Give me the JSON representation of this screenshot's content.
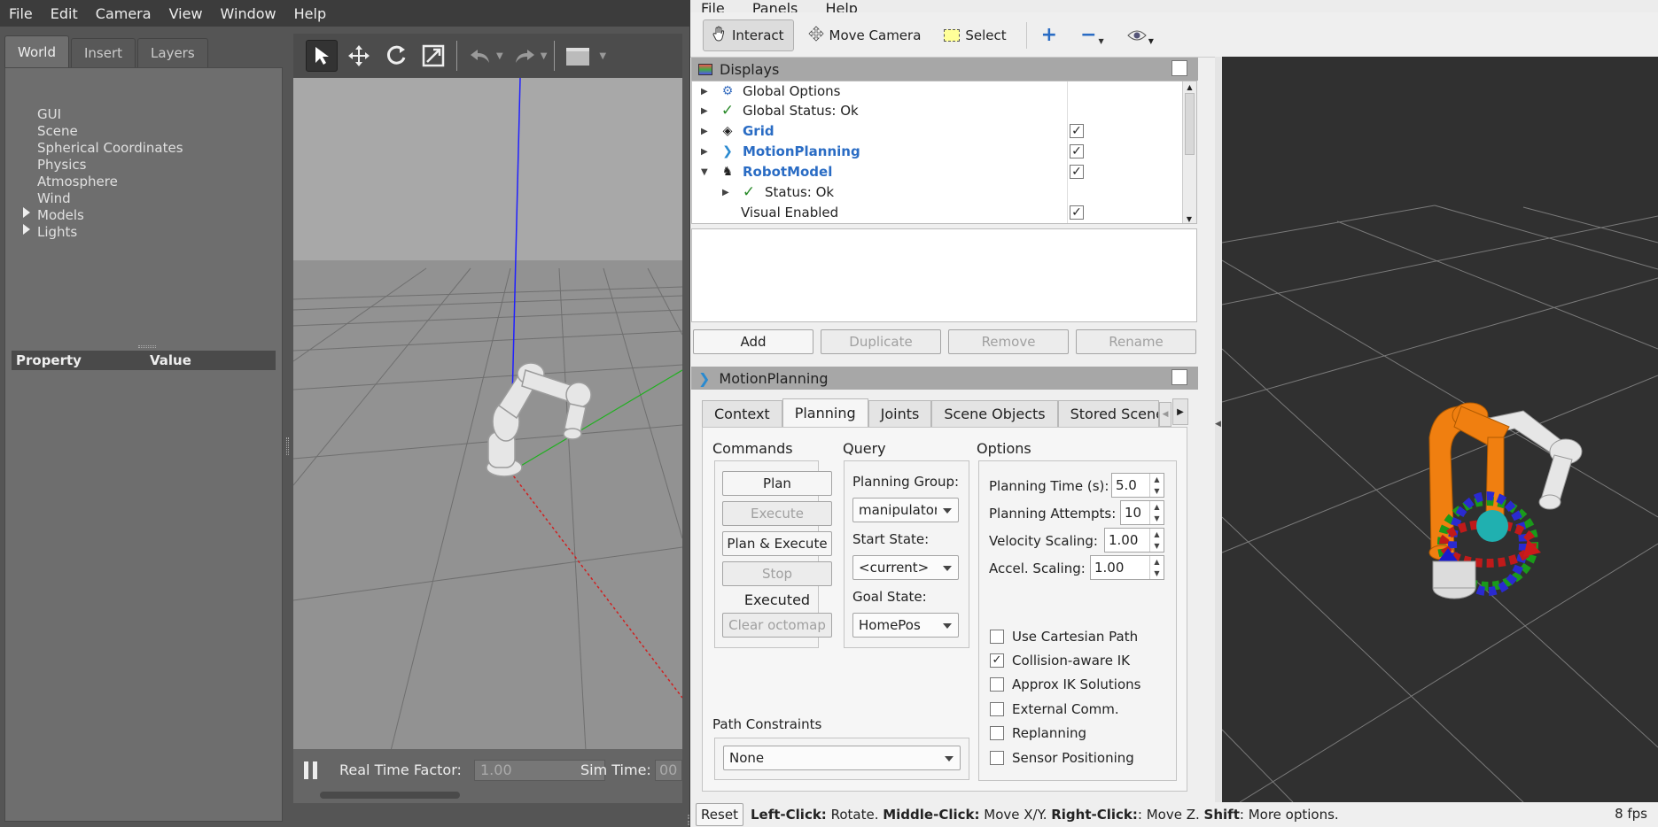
{
  "gazebo": {
    "menu": [
      "File",
      "Edit",
      "Camera",
      "View",
      "Window",
      "Help"
    ],
    "tabs": [
      "World",
      "Insert",
      "Layers"
    ],
    "tree": [
      "GUI",
      "Scene",
      "Spherical Coordinates",
      "Physics",
      "Atmosphere",
      "Wind",
      "Models",
      "Lights"
    ],
    "property_header": "Property",
    "value_header": "Value",
    "real_time_factor_label": "Real Time Factor:",
    "real_time_factor": "1.00",
    "sim_time_label": "Sim Time:",
    "sim_time": "00"
  },
  "rviz": {
    "menu": [
      "File",
      "Panels",
      "Help"
    ],
    "toolbar": {
      "interact": "Interact",
      "move_camera": "Move Camera",
      "select": "Select"
    },
    "displays": {
      "title": "Displays",
      "rows": [
        "Global Options",
        "Global Status: Ok",
        "Grid",
        "MotionPlanning",
        "RobotModel",
        "Status: Ok",
        "Visual Enabled"
      ]
    },
    "buttons": {
      "add": "Add",
      "duplicate": "Duplicate",
      "remove": "Remove",
      "rename": "Rename"
    },
    "motion_panel": {
      "title": "MotionPlanning",
      "tabs": [
        "Context",
        "Planning",
        "Joints",
        "Scene Objects",
        "Stored Scenes"
      ],
      "commands_label": "Commands",
      "query_label": "Query",
      "options_label": "Options",
      "plan": "Plan",
      "execute": "Execute",
      "plan_execute": "Plan & Execute",
      "stop": "Stop",
      "executed": "Executed",
      "clear_octomap": "Clear octomap",
      "planning_group_label": "Planning Group:",
      "planning_group": "manipulator",
      "start_state_label": "Start State:",
      "start_state": "<current>",
      "goal_state_label": "Goal State:",
      "goal_state": "HomePos",
      "planning_time_label": "Planning Time (s):",
      "planning_time": "5.0",
      "planning_attempts_label": "Planning Attempts:",
      "planning_attempts": "10",
      "velocity_scaling_label": "Velocity Scaling:",
      "velocity_scaling": "1.00",
      "accel_scaling_label": "Accel. Scaling:",
      "accel_scaling": "1.00",
      "use_cartesian": "Use Cartesian Path",
      "collision_ik": "Collision-aware IK",
      "approx_ik": "Approx IK Solutions",
      "external_comm": "External Comm.",
      "replanning": "Replanning",
      "sensor_positioning": "Sensor Positioning",
      "path_constraints_label": "Path Constraints",
      "path_constraints": "None"
    },
    "status": {
      "reset": "Reset",
      "left_click": "Left-Click:",
      "left_action": " Rotate. ",
      "middle_click": "Middle-Click:",
      "middle_action": " Move X/Y. ",
      "right_click": "Right-Click:",
      "right_action": ": Move Z. ",
      "shift": "Shift",
      "shift_action": ": More options.",
      "fps": "8 fps"
    }
  }
}
